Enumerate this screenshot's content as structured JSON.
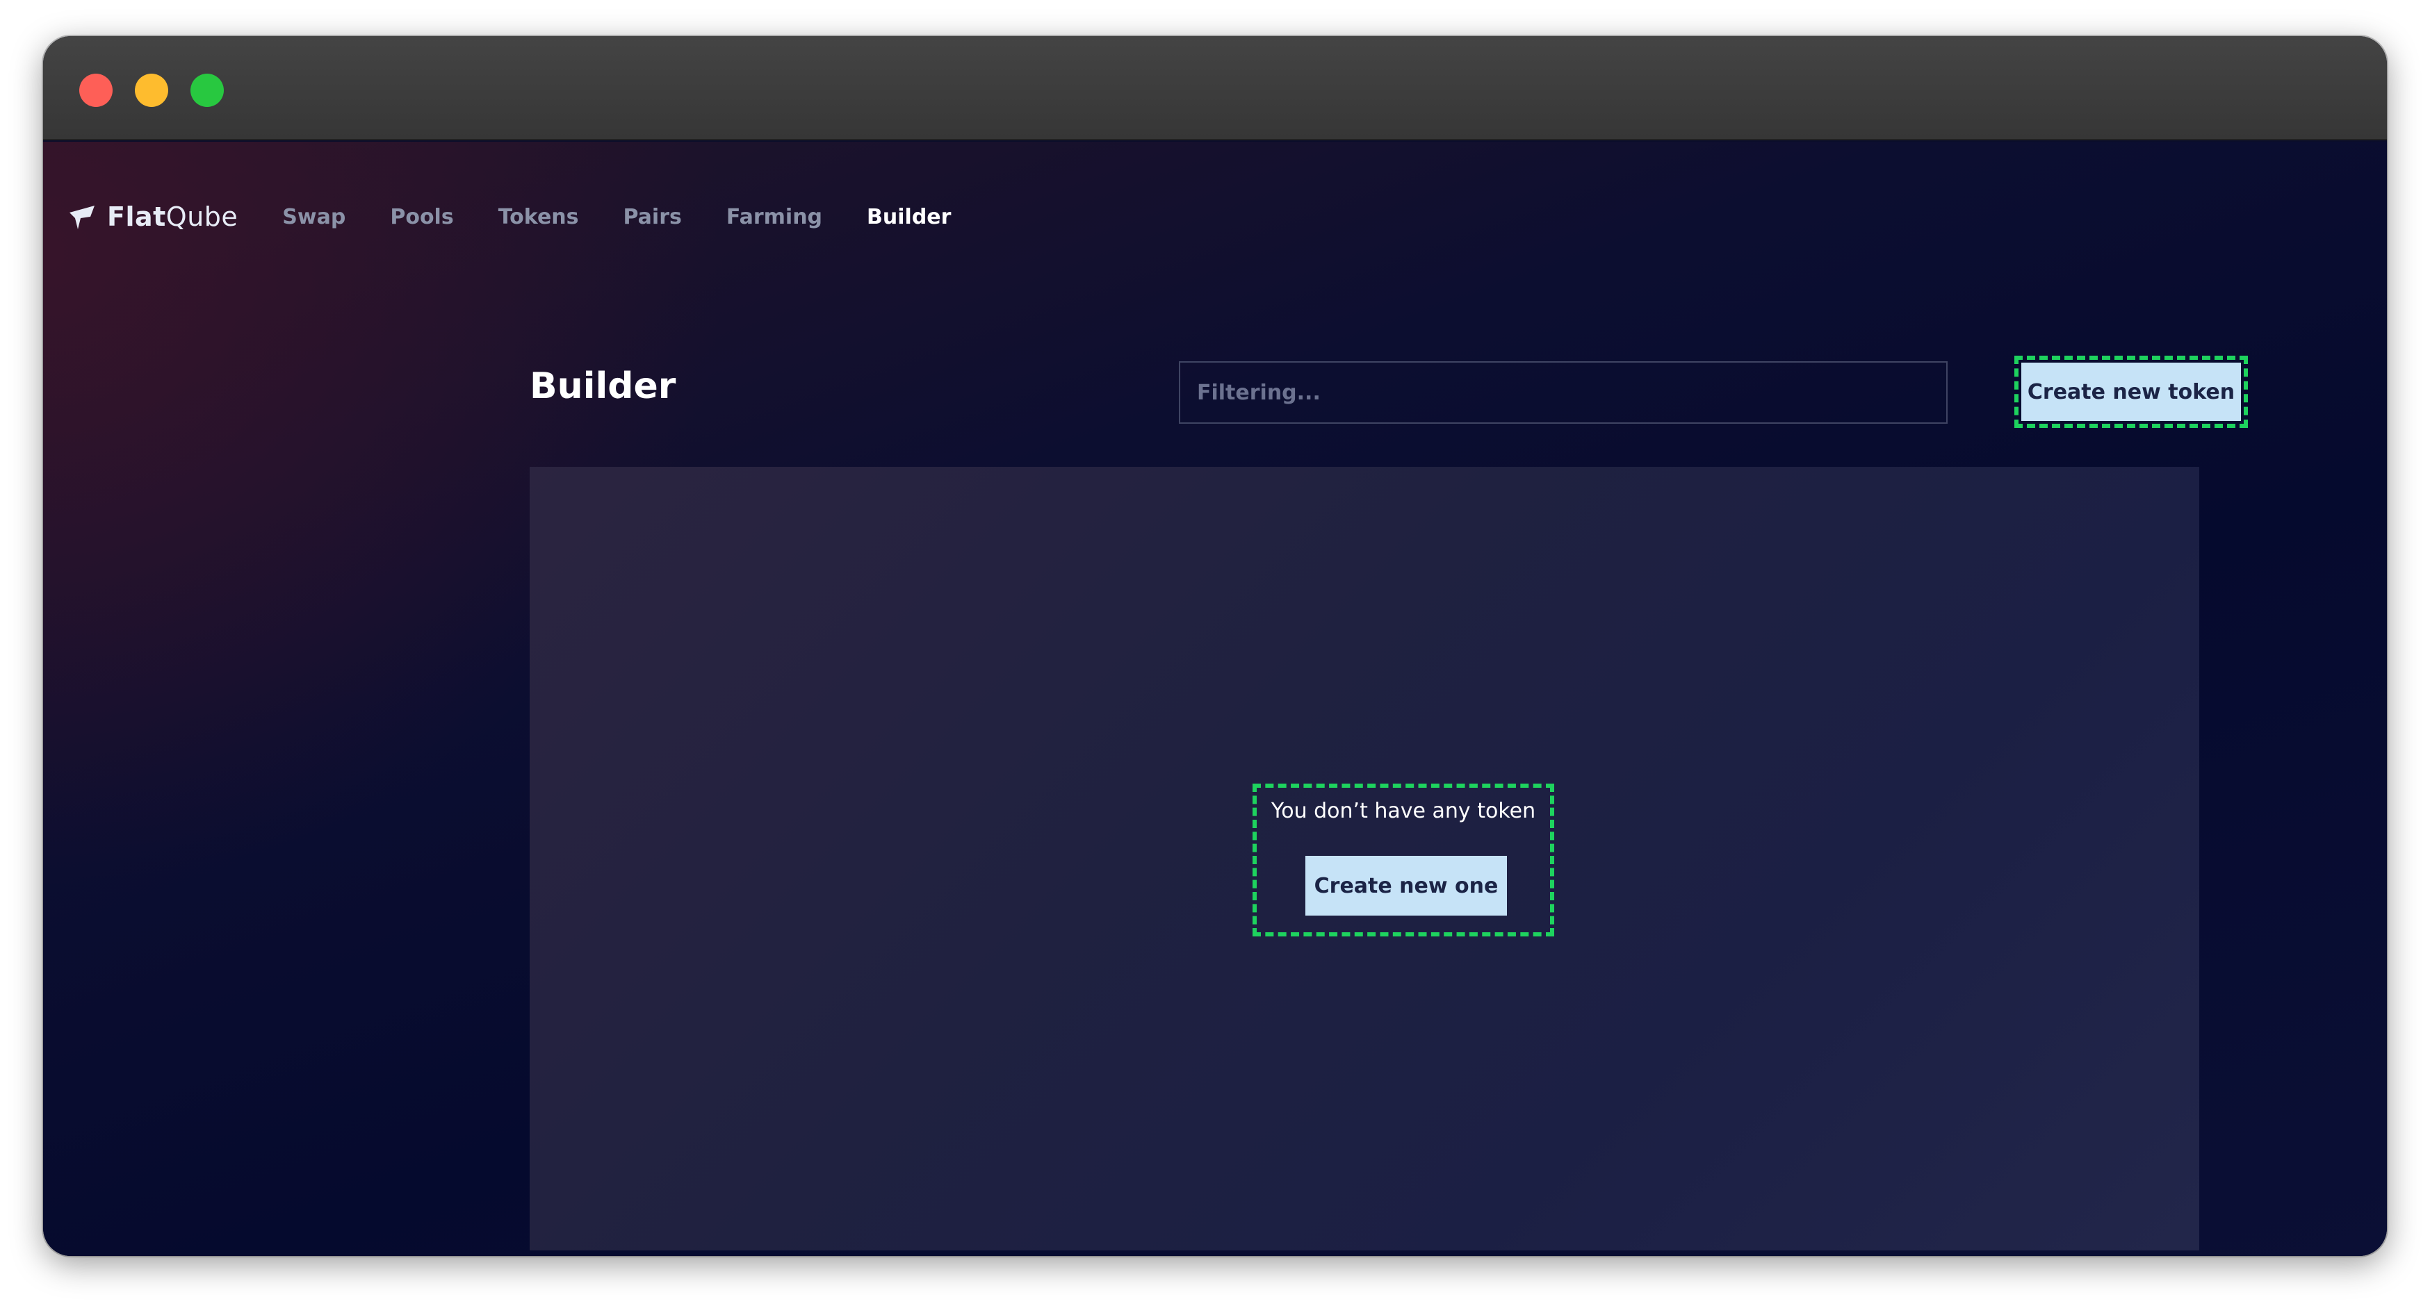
{
  "window": {
    "controls": [
      "close-button",
      "minimize-button",
      "zoom-button"
    ]
  },
  "brand": {
    "name_bold": "Flat",
    "name_regular": "Qube",
    "icon": "flatqube-logo-icon"
  },
  "nav": {
    "items": [
      {
        "label": "Swap",
        "active": false
      },
      {
        "label": "Pools",
        "active": false
      },
      {
        "label": "Tokens",
        "active": false
      },
      {
        "label": "Pairs",
        "active": false
      },
      {
        "label": "Farming",
        "active": false
      },
      {
        "label": "Builder",
        "active": true
      }
    ]
  },
  "page": {
    "title": "Builder",
    "filter_placeholder": "Filtering...",
    "create_token_label": "Create new token"
  },
  "empty_state": {
    "message": "You don’t have any token",
    "button_label": "Create new one"
  },
  "colors": {
    "accent_button": "#c6e3f7",
    "highlight_dash": "#1ed35e",
    "nav_inactive": "#8b92a8",
    "nav_active": "#ffffff"
  }
}
